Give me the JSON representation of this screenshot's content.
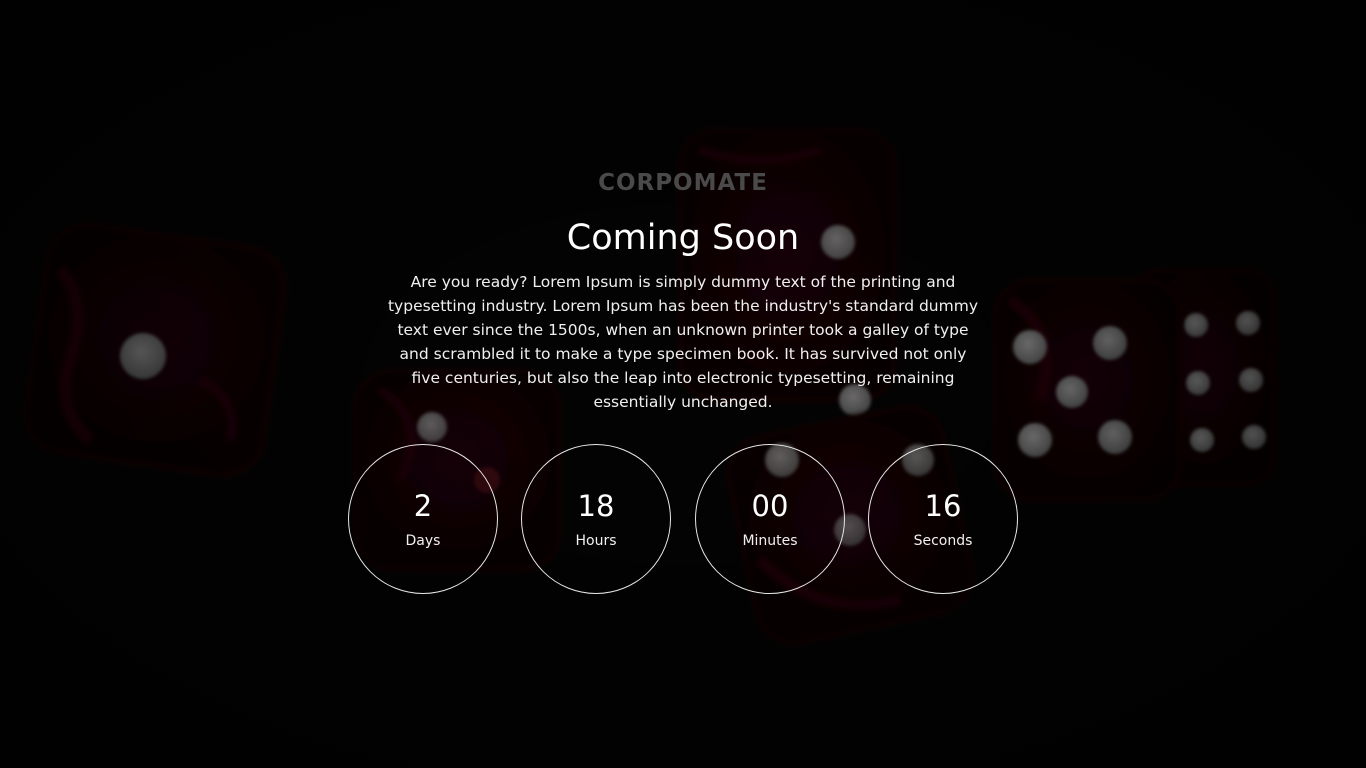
{
  "brand": {
    "logo_text": "CORPOMATE"
  },
  "hero": {
    "title": "Coming Soon",
    "description": "Are you ready? Lorem Ipsum is simply dummy text of the printing and typesetting industry. Lorem Ipsum has been the industry's standard dummy text ever since the 1500s, when an unknown printer took a galley of type and scrambled it to make a type specimen book. It has survived not only five centuries, but also the leap into electronic typesetting, remaining essentially unchanged."
  },
  "countdown": {
    "days": {
      "value": "2",
      "label": "Days"
    },
    "hours": {
      "value": "18",
      "label": "Hours"
    },
    "minutes": {
      "value": "00",
      "label": "Minutes"
    },
    "seconds": {
      "value": "16",
      "label": "Seconds"
    }
  },
  "colors": {
    "background": "#000000",
    "dice_red": "#5a0a12",
    "circle_border": "#e6e6e6",
    "logo": "#4a4a4a"
  }
}
